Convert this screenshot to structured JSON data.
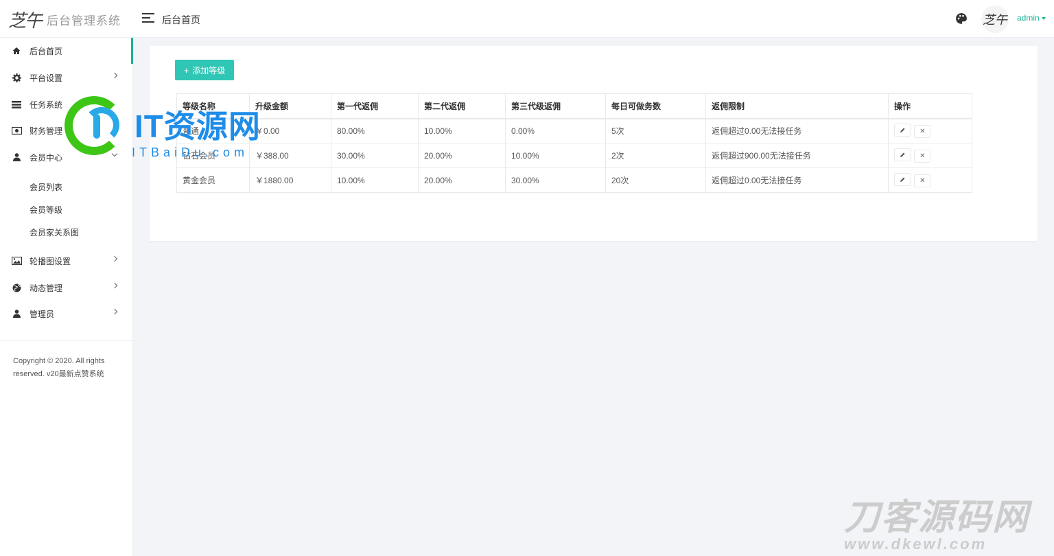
{
  "app": {
    "logo_mark": "芝午",
    "title": "后台管理系统"
  },
  "header": {
    "page_title": "后台首页",
    "avatar_text": "芝午",
    "user_name": "admin"
  },
  "sidebar": {
    "items": [
      {
        "label": "后台首页",
        "icon": "home-icon",
        "active": true
      },
      {
        "label": "平台设置",
        "icon": "gear-icon",
        "arrow": "right"
      },
      {
        "label": "任务系统",
        "icon": "task-list-icon"
      },
      {
        "label": "财务管理",
        "icon": "money-icon"
      },
      {
        "label": "会员中心",
        "icon": "user-icon",
        "arrow": "down"
      },
      {
        "label": "轮播图设置",
        "icon": "image-icon",
        "arrow": "right"
      },
      {
        "label": "动态管理",
        "icon": "globe-icon",
        "arrow": "right"
      },
      {
        "label": "管理员",
        "icon": "user-icon",
        "arrow": "right"
      }
    ],
    "sub_items": [
      "会员列表",
      "会员等级",
      "会员家关系图"
    ],
    "copyright": "Copyright © 2020. All rights reserved. v20最新点赞系统"
  },
  "main": {
    "add_button_label": "添加等级",
    "table": {
      "headers": [
        "等级名称",
        "升级金额",
        "第一代返佣",
        "第二代返佣",
        "第三代级返佣",
        "每日可做务数",
        "返佣限制",
        "操作"
      ],
      "rows": [
        [
          "普通",
          "￥0.00",
          "80.00%",
          "10.00%",
          "0.00%",
          "5次",
          "返佣超过0.00无法接任务"
        ],
        [
          "钻石会员",
          "￥388.00",
          "30.00%",
          "20.00%",
          "10.00%",
          "2次",
          "返佣超过900.00无法接任务"
        ],
        [
          "黄金会员",
          "￥1880.00",
          "10.00%",
          "20.00%",
          "30.00%",
          "20次",
          "返佣超过0.00无法接任务"
        ]
      ]
    }
  },
  "watermarks": {
    "wm1_title": "IT资源网",
    "wm1_sub": "ITBaiDu.com",
    "wm2_title": "刀客源码网",
    "wm2_sub": "www.dkewl.com"
  },
  "colors": {
    "accent": "#1ab394",
    "button": "#2fc6b5"
  }
}
